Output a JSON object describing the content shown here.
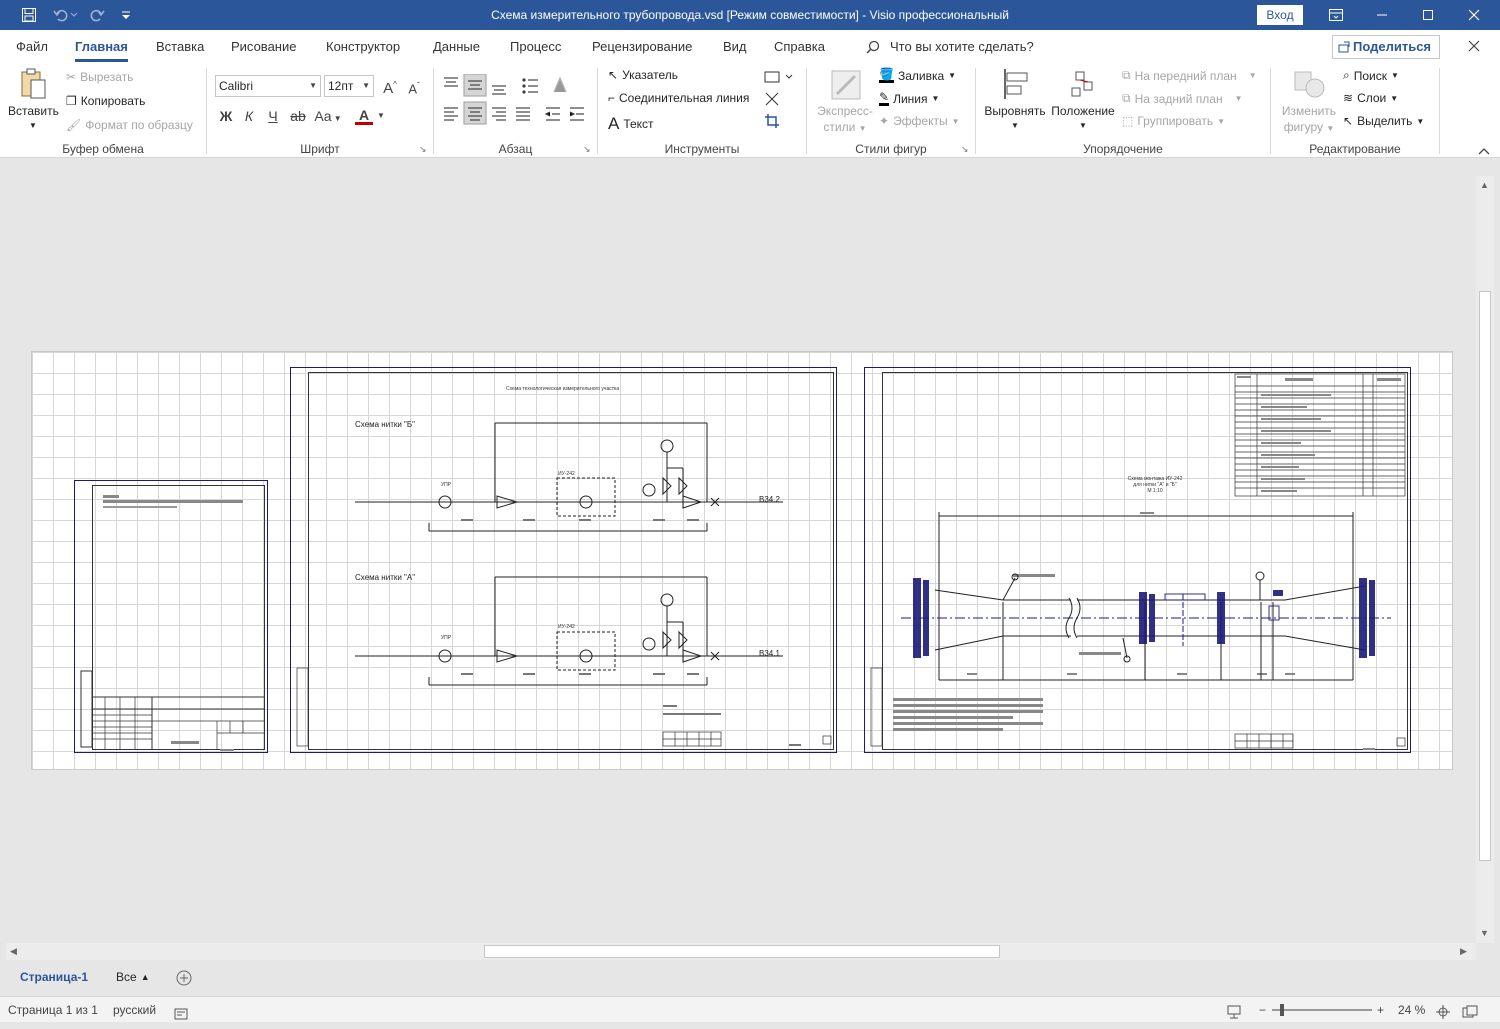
{
  "window": {
    "title": "Схема измерительного трубопровода.vsd  [Режим совместимости]  -  Visio профессиональный",
    "signin_label": "Вход"
  },
  "tabs": [
    "Файл",
    "Главная",
    "Вставка",
    "Рисование",
    "Конструктор",
    "Данные",
    "Процесс",
    "Рецензирование",
    "Вид",
    "Справка"
  ],
  "active_tab": "Главная",
  "tell_me": "Что вы хотите сделать?",
  "share_label": "Поделиться",
  "ribbon": {
    "clipboard": {
      "paste": "Вставить",
      "cut": "Вырезать",
      "copy": "Копировать",
      "format_painter": "Формат по образцу",
      "label": "Буфер обмена"
    },
    "font": {
      "family": "Calibri",
      "size": "12пт",
      "bold": "Ж",
      "italic": "К",
      "underline": "Ч",
      "strike": "ab",
      "case": "Aa",
      "color_glyph": "A",
      "label": "Шрифт"
    },
    "paragraph": {
      "label": "Абзац"
    },
    "tools": {
      "pointer": "Указатель",
      "connector": "Соединительная линия",
      "text": "Текст",
      "label": "Инструменты"
    },
    "shape_styles": {
      "quick_styles_1": "Экспресс-",
      "quick_styles_2": "стили",
      "fill": "Заливка",
      "line": "Линия",
      "effects": "Эффекты",
      "label": "Стили фигур"
    },
    "arrange": {
      "align": "Выровнять",
      "position": "Положение",
      "bring_front": "На передний план",
      "send_back": "На задний план",
      "group": "Группировать",
      "label": "Упорядочение"
    },
    "editing": {
      "change_shape_1": "Изменить",
      "change_shape_2": "фигуру",
      "find": "Поиск",
      "layers": "Слои",
      "select": "Выделить",
      "label": "Редактирование"
    }
  },
  "drawing": {
    "sheet2_title": "Схема технологическая измерительного участка",
    "scheme_b": "Схема нитки \"Б\"",
    "scheme_a": "Схема нитки \"А\"",
    "out_b": "В34.2",
    "out_a": "В34.1",
    "ip_b": "ИУ-242",
    "ip_a": "ИУ-242",
    "upr": "УПР",
    "sheet3_title_1": "Схема монтажа ИУ-242",
    "sheet3_title_2": "для нитки \"А\" и \"Б\"",
    "sheet3_title_3": "М 1:10"
  },
  "pagebar": {
    "page_tab": "Страница-1",
    "all_pages": "Все"
  },
  "status": {
    "page": "Страница 1 из 1",
    "language": "русский",
    "zoom": "24 %"
  },
  "colors": {
    "accent": "#2b579a",
    "sheet_border": "#1a1a7a",
    "grid": "#d6d6d6"
  }
}
